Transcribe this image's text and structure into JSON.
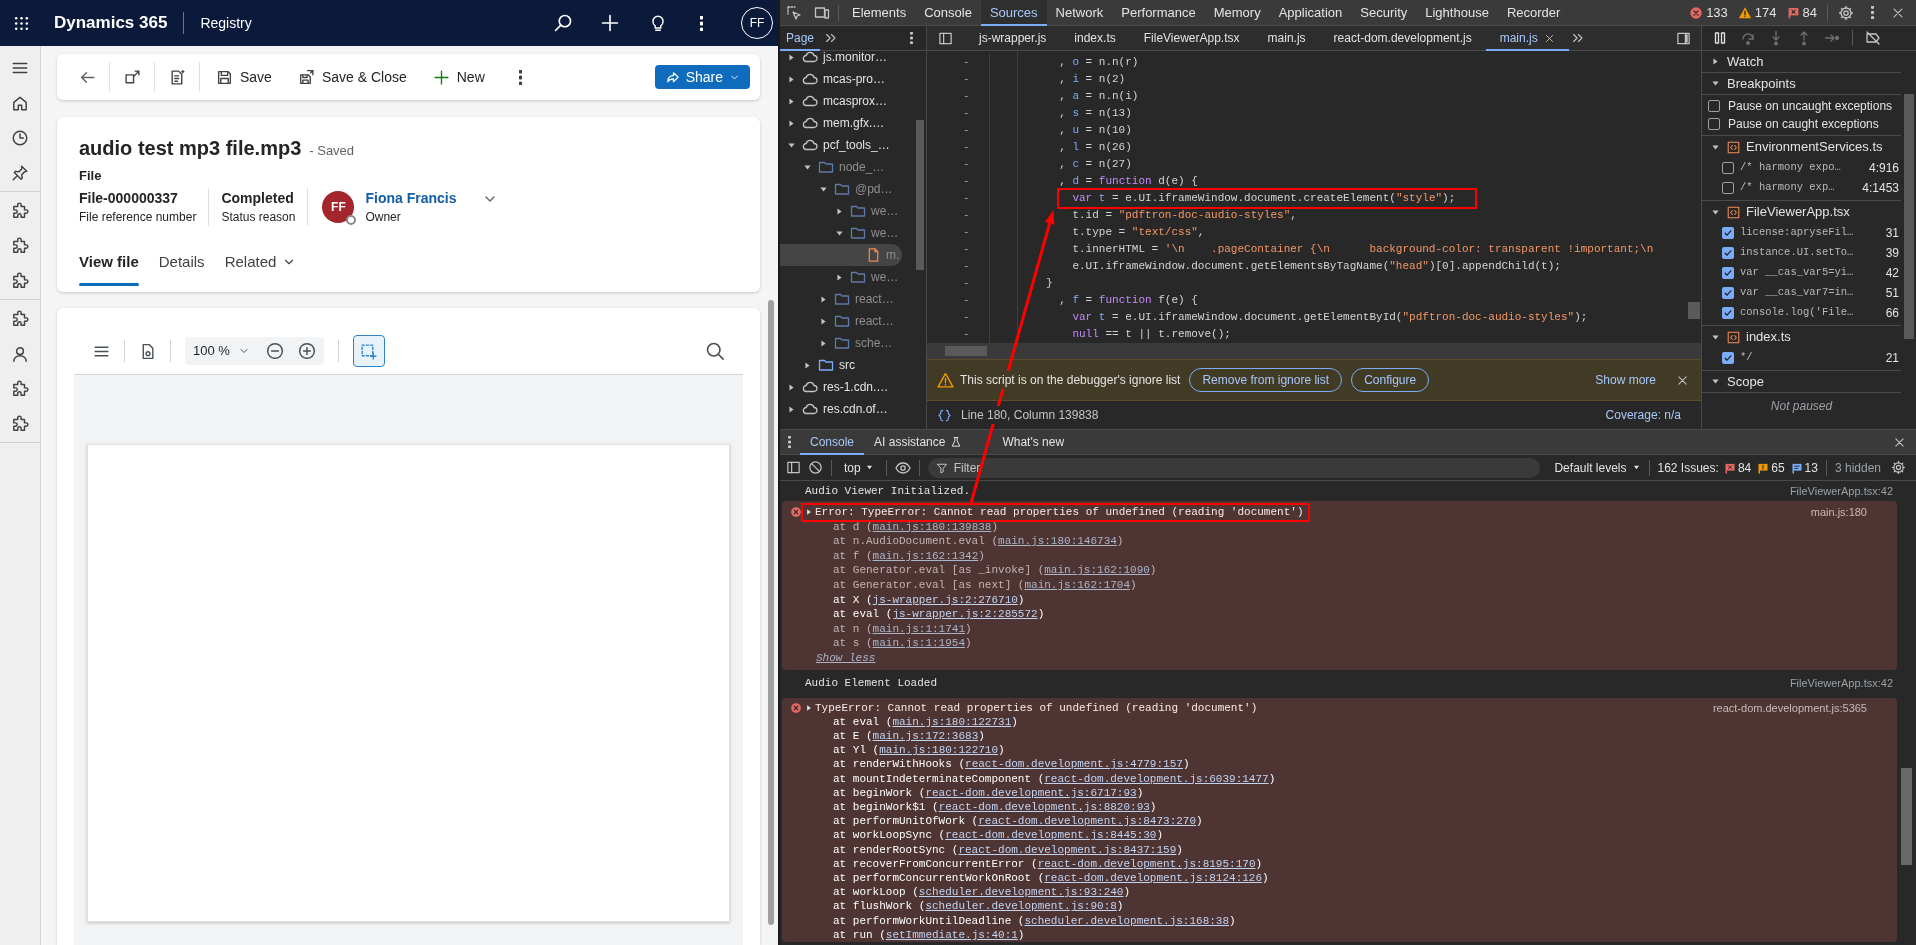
{
  "app": {
    "brand": "Dynamics 365",
    "area": "Registry",
    "user_initials": "FF",
    "commands": [
      {
        "kind": "save",
        "label": "Save"
      },
      {
        "kind": "save_close",
        "label": "Save & Close"
      },
      {
        "kind": "new",
        "label": "New"
      }
    ],
    "share": "Share",
    "record": {
      "title": "audio test mp3 file.mp3",
      "save_state": "- Saved",
      "entity": "File",
      "fields": [
        {
          "value": "File-000000337",
          "label": "File reference number"
        },
        {
          "value": "Completed",
          "label": "Status reason"
        }
      ],
      "owner": {
        "initials": "FF",
        "name": "Fiona Francis",
        "label": "Owner"
      }
    },
    "tabs": [
      {
        "label": "View file",
        "selected": true,
        "menu": false
      },
      {
        "label": "Details",
        "selected": false,
        "menu": false
      },
      {
        "label": "Related",
        "selected": false,
        "menu": true
      }
    ],
    "viewer": {
      "zoom": "100 %",
      "select_tool_active": true
    }
  },
  "devtools": {
    "panels": [
      {
        "label": "Elements",
        "selected": false
      },
      {
        "label": "Console",
        "selected": false
      },
      {
        "label": "Sources",
        "selected": true
      },
      {
        "label": "Network",
        "selected": false
      },
      {
        "label": "Performance",
        "selected": false
      },
      {
        "label": "Memory",
        "selected": false
      },
      {
        "label": "Application",
        "selected": false
      },
      {
        "label": "Security",
        "selected": false
      },
      {
        "label": "Lighthouse",
        "selected": false
      },
      {
        "label": "Recorder",
        "selected": false
      }
    ],
    "counts": {
      "errors": "133",
      "warnings": "174",
      "issues": "84"
    },
    "navigator_tab": {
      "label": "Page",
      "selected": true
    },
    "tree": [
      {
        "label": "js.monitor…",
        "kind": "domain",
        "expanded": false,
        "selected": false,
        "dimmed": false
      },
      {
        "label": "mcas-pro…",
        "kind": "domain",
        "expanded": false,
        "selected": false,
        "dimmed": false
      },
      {
        "label": "mcasprox…",
        "kind": "domain",
        "expanded": false,
        "selected": false,
        "dimmed": false
      },
      {
        "label": "mem.gfx.…",
        "kind": "domain",
        "expanded": false,
        "selected": false,
        "dimmed": false
      },
      {
        "label": "pcf_tools_…",
        "kind": "domain",
        "expanded": true,
        "selected": false,
        "dimmed": false,
        "children": [
          {
            "label": "node_…",
            "kind": "folder",
            "expanded": true,
            "selected": false,
            "dimmed": true,
            "children": [
              {
                "label": "@pd…",
                "kind": "folder",
                "expanded": true,
                "selected": false,
                "dimmed": true,
                "children": [
                  {
                    "label": "we…",
                    "kind": "folder",
                    "expanded": false,
                    "selected": false,
                    "dimmed": true
                  },
                  {
                    "label": "we…",
                    "kind": "folder",
                    "expanded": true,
                    "selected": false,
                    "dimmed": true,
                    "children": [
                      {
                        "label": "m.",
                        "kind": "file",
                        "selected": true,
                        "dimmed": true
                      }
                    ]
                  },
                  {
                    "label": "we…",
                    "kind": "folder",
                    "expanded": false,
                    "selected": false,
                    "dimmed": true
                  }
                ]
              },
              {
                "label": "react…",
                "kind": "folder",
                "expanded": false,
                "selected": false,
                "dimmed": true
              },
              {
                "label": "react…",
                "kind": "folder",
                "expanded": false,
                "selected": false,
                "dimmed": true
              },
              {
                "label": "sche…",
                "kind": "folder",
                "expanded": false,
                "selected": false,
                "dimmed": true
              }
            ]
          },
          {
            "label": "src",
            "kind": "folder",
            "expanded": false,
            "selected": false,
            "dimmed": false
          }
        ]
      },
      {
        "label": "res-1.cdn.…",
        "kind": "domain",
        "expanded": false,
        "selected": false,
        "dimmed": false
      },
      {
        "label": "res.cdn.of…",
        "kind": "domain",
        "expanded": false,
        "selected": false,
        "dimmed": false
      }
    ],
    "editor_tabs": [
      {
        "label": "js-wrapper.js",
        "selected": false
      },
      {
        "label": "index.ts",
        "selected": false
      },
      {
        "label": "FileViewerApp.tsx",
        "selected": false
      },
      {
        "label": "main.js",
        "selected": false
      },
      {
        "label": "react-dom.development.js",
        "selected": false
      },
      {
        "label": "main.js",
        "selected": true
      }
    ],
    "code": [
      {
        "number": "-",
        "boxed": false,
        "tokens": [
          {
            "kind": "plain",
            "text": "  , "
          },
          {
            "kind": "def",
            "text": "o"
          },
          {
            "kind": "plain",
            "text": " = n.n(r)"
          }
        ]
      },
      {
        "number": "-",
        "boxed": false,
        "tokens": [
          {
            "kind": "plain",
            "text": "  , "
          },
          {
            "kind": "def",
            "text": "i"
          },
          {
            "kind": "plain",
            "text": " = n(2)"
          }
        ]
      },
      {
        "number": "-",
        "boxed": false,
        "tokens": [
          {
            "kind": "plain",
            "text": "  , "
          },
          {
            "kind": "def",
            "text": "a"
          },
          {
            "kind": "plain",
            "text": " = n.n(i)"
          }
        ]
      },
      {
        "number": "-",
        "boxed": false,
        "tokens": [
          {
            "kind": "plain",
            "text": "  , "
          },
          {
            "kind": "def",
            "text": "s"
          },
          {
            "kind": "plain",
            "text": " = n(13)"
          }
        ]
      },
      {
        "number": "-",
        "boxed": false,
        "tokens": [
          {
            "kind": "plain",
            "text": "  , "
          },
          {
            "kind": "def",
            "text": "u"
          },
          {
            "kind": "plain",
            "text": " = n(10)"
          }
        ]
      },
      {
        "number": "-",
        "boxed": false,
        "tokens": [
          {
            "kind": "plain",
            "text": "  , "
          },
          {
            "kind": "def",
            "text": "l"
          },
          {
            "kind": "plain",
            "text": " = n(26)"
          }
        ]
      },
      {
        "number": "-",
        "boxed": false,
        "tokens": [
          {
            "kind": "plain",
            "text": "  , "
          },
          {
            "kind": "def",
            "text": "c"
          },
          {
            "kind": "plain",
            "text": " = n(27)"
          }
        ]
      },
      {
        "number": "-",
        "boxed": false,
        "tokens": [
          {
            "kind": "plain",
            "text": "  , "
          },
          {
            "kind": "def",
            "text": "d"
          },
          {
            "kind": "plain",
            "text": " = "
          },
          {
            "kind": "keyword",
            "text": "function"
          },
          {
            "kind": "plain",
            "text": " d(e) {"
          }
        ]
      },
      {
        "number": "-",
        "boxed": true,
        "tokens": [
          {
            "kind": "keyword",
            "text": "    var"
          },
          {
            "kind": "def",
            "text": " t"
          },
          {
            "kind": "plain",
            "text": " = e.UI.iframeWindow.document.createElement("
          },
          {
            "kind": "string",
            "text": "\"style\""
          },
          {
            "kind": "plain",
            "text": ");"
          }
        ]
      },
      {
        "number": "-",
        "boxed": false,
        "tokens": [
          {
            "kind": "plain",
            "text": "    t.id = "
          },
          {
            "kind": "string",
            "text": "\"pdftron-doc-audio-styles\""
          },
          {
            "kind": "plain",
            "text": ","
          }
        ]
      },
      {
        "number": "-",
        "boxed": false,
        "tokens": [
          {
            "kind": "plain",
            "text": "    t.type = "
          },
          {
            "kind": "string",
            "text": "\"text/css\""
          },
          {
            "kind": "plain",
            "text": ","
          }
        ]
      },
      {
        "number": "-",
        "boxed": false,
        "tokens": [
          {
            "kind": "plain",
            "text": "    t.innerHTML = "
          },
          {
            "kind": "string",
            "text": "'\\n    .pageContainer {\\n      background-color: transparent !important;\\n"
          }
        ]
      },
      {
        "number": "-",
        "boxed": false,
        "tokens": [
          {
            "kind": "plain",
            "text": "    e.UI.iframeWindow.document.getElementsByTagName("
          },
          {
            "kind": "string",
            "text": "\"head\""
          },
          {
            "kind": "plain",
            "text": ")[0].appendChild(t);"
          }
        ]
      },
      {
        "number": "-",
        "boxed": false,
        "tokens": [
          {
            "kind": "plain",
            "text": "}"
          }
        ]
      },
      {
        "number": "-",
        "boxed": false,
        "tokens": [
          {
            "kind": "plain",
            "text": "  , "
          },
          {
            "kind": "def",
            "text": "f"
          },
          {
            "kind": "plain",
            "text": " = "
          },
          {
            "kind": "keyword",
            "text": "function"
          },
          {
            "kind": "plain",
            "text": " f(e) {"
          }
        ]
      },
      {
        "number": "-",
        "boxed": false,
        "tokens": [
          {
            "kind": "keyword",
            "text": "    var"
          },
          {
            "kind": "def",
            "text": " t"
          },
          {
            "kind": "plain",
            "text": " = e.UI.iframeWindow.document.getElementById("
          },
          {
            "kind": "string",
            "text": "\"pdftron-doc-audio-styles\""
          },
          {
            "kind": "plain",
            "text": ");"
          }
        ]
      },
      {
        "number": "-",
        "boxed": false,
        "tokens": [
          {
            "kind": "keyword",
            "text": "    null"
          },
          {
            "kind": "plain",
            "text": " == t || t.remove();"
          }
        ]
      }
    ],
    "ignore_bar": {
      "message": "This script is on the debugger's ignore list",
      "buttons": [
        "Remove from ignore list",
        "Configure"
      ],
      "more": "Show more"
    },
    "status": {
      "position": "Line 180, Column 139838",
      "coverage": "Coverage: n/a"
    },
    "debugger": {
      "watch": {
        "label": "Watch",
        "expanded": false
      },
      "breakpoints": {
        "label": "Breakpoints",
        "expanded": true,
        "options": [
          {
            "label": "Pause on uncaught exceptions",
            "checked": false
          },
          {
            "label": "Pause on caught exceptions",
            "checked": false
          }
        ],
        "files": [
          {
            "name": "EnvironmentServices.ts",
            "expanded": true,
            "items": [
              {
                "code": "/* harmony expo…",
                "location": "4:916",
                "checked": false
              },
              {
                "code": "/* harmony exp…",
                "location": "4:1453",
                "checked": false
              }
            ]
          },
          {
            "name": "FileViewerApp.tsx",
            "expanded": true,
            "items": [
              {
                "code": "license:apryseFil…",
                "location": "31",
                "checked": true
              },
              {
                "code": "instance.UI.setTo…",
                "location": "39",
                "checked": true
              },
              {
                "code": "var __cas_var5=yi…",
                "location": "42",
                "checked": true
              },
              {
                "code": "var __cas_var7=in…",
                "location": "51",
                "checked": true
              },
              {
                "code": "console.log('File…",
                "location": "66",
                "checked": true
              }
            ]
          },
          {
            "name": "index.ts",
            "expanded": true,
            "items": [
              {
                "code": "*/",
                "location": "21",
                "checked": true
              }
            ]
          }
        ]
      },
      "scope": {
        "label": "Scope",
        "expanded": true,
        "message": "Not paused"
      }
    }
  },
  "console": {
    "tabs": [
      {
        "label": "Console",
        "selected": true
      },
      {
        "label": "AI assistance",
        "selected": false
      },
      {
        "label": "What's new",
        "selected": false
      }
    ],
    "context": "top",
    "filter_placeholder": "Filter",
    "levels": "Default levels",
    "issues": {
      "label": "162 Issues:",
      "errors": "84",
      "warnings": "65",
      "info": "13"
    },
    "hidden": "3 hidden",
    "messages": [
      {
        "kind": "log",
        "boxed": false,
        "text": "Audio Viewer Initialized.",
        "source": "FileViewerApp.tsx:42"
      },
      {
        "kind": "error",
        "boxed": true,
        "text": "Error: TypeError: Cannot read properties of undefined (reading 'document')",
        "source": "main.js:180",
        "toggle": "Show less",
        "frames": [
          {
            "before": "at d (",
            "link": "main.js:180:139838",
            "after": ")",
            "dimmed": true
          },
          {
            "before": "at n.AudioDocument.eval (",
            "link": "main.js:180:146734",
            "after": ")",
            "dimmed": true
          },
          {
            "before": "at f (",
            "link": "main.js:162:1342",
            "after": ")",
            "dimmed": true
          },
          {
            "before": "at Generator.eval [as _invoke] (",
            "link": "main.js:162:1090",
            "after": ")",
            "dimmed": true
          },
          {
            "before": "at Generator.eval [as next] (",
            "link": "main.js:162:1704",
            "after": ")",
            "dimmed": true
          },
          {
            "before": "at X (",
            "link": "js-wrapper.js:2:276710",
            "after": ")",
            "dimmed": false
          },
          {
            "before": "at eval (",
            "link": "js-wrapper.js:2:285572",
            "after": ")",
            "dimmed": false
          },
          {
            "before": "at n (",
            "link": "main.js:1:1741",
            "after": ")",
            "dimmed": true
          },
          {
            "before": "at s (",
            "link": "main.js:1:1954",
            "after": ")",
            "dimmed": true
          }
        ]
      },
      {
        "kind": "log",
        "boxed": false,
        "text": "Audio Element Loaded",
        "source": "FileViewerApp.tsx:42"
      },
      {
        "kind": "error",
        "boxed": false,
        "text": "TypeError: Cannot read properties of undefined (reading 'document')",
        "source": "react-dom.development.js:5365",
        "frames": [
          {
            "before": "at eval (",
            "link": "main.js:180:122731",
            "after": ")",
            "dimmed": false
          },
          {
            "before": "at E (",
            "link": "main.js:172:3683",
            "after": ")",
            "dimmed": false
          },
          {
            "before": "at Yl (",
            "link": "main.js:180:122710",
            "after": ")",
            "dimmed": false
          },
          {
            "before": "at renderWithHooks (",
            "link": "react-dom.development.js:4779:157",
            "after": ")",
            "dimmed": false
          },
          {
            "before": "at mountIndeterminateComponent (",
            "link": "react-dom.development.js:6039:1477",
            "after": ")",
            "dimmed": false
          },
          {
            "before": "at beginWork (",
            "link": "react-dom.development.js:6717:93",
            "after": ")",
            "dimmed": false
          },
          {
            "before": "at beginWork$1 (",
            "link": "react-dom.development.js:8820:93",
            "after": ")",
            "dimmed": false
          },
          {
            "before": "at performUnitOfWork (",
            "link": "react-dom.development.js:8473:270",
            "after": ")",
            "dimmed": false
          },
          {
            "before": "at workLoopSync (",
            "link": "react-dom.development.js:8445:30",
            "after": ")",
            "dimmed": false
          },
          {
            "before": "at renderRootSync (",
            "link": "react-dom.development.js:8437:159",
            "after": ")",
            "dimmed": false
          },
          {
            "before": "at recoverFromConcurrentError (",
            "link": "react-dom.development.js:8195:170",
            "after": ")",
            "dimmed": false
          },
          {
            "before": "at performConcurrentWorkOnRoot (",
            "link": "react-dom.development.js:8124:126",
            "after": ")",
            "dimmed": false
          },
          {
            "before": "at workLoop (",
            "link": "scheduler.development.js:93:240",
            "after": ")",
            "dimmed": false
          },
          {
            "before": "at flushWork (",
            "link": "scheduler.development.js:90:8",
            "after": ")",
            "dimmed": false
          },
          {
            "before": "at performWorkUntilDeadline (",
            "link": "scheduler.development.js:168:38",
            "after": ")",
            "dimmed": false
          },
          {
            "before": "at run (",
            "link": "setImmediate.js:40:1",
            "after": ")",
            "dimmed": false
          }
        ]
      }
    ]
  }
}
